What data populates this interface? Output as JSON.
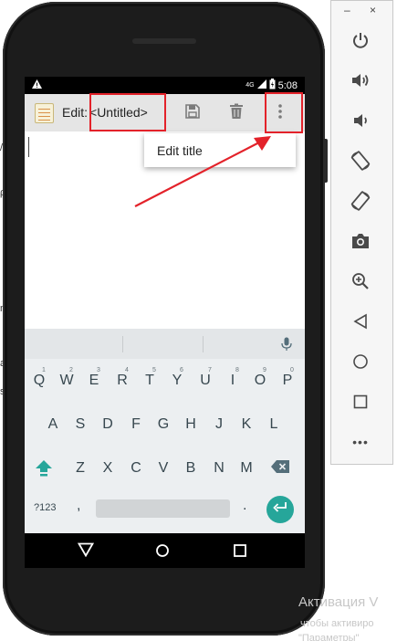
{
  "colors": {
    "accent_teal": "#26a69a",
    "highlight_red": "#e3222a",
    "actionbar_bg": "#e5e5e5",
    "keyboard_bg": "#eceff1"
  },
  "background_fragments": [
    "/",
    "ρ",
    "m",
    "a",
    "s"
  ],
  "status_bar": {
    "alert_icon": "warning-icon",
    "network": "4G",
    "battery_icon": "battery-charging-icon",
    "time": "5:08"
  },
  "action_bar": {
    "title_prefix": "Edit:",
    "title_value": "<Untitled>",
    "app_icon": "notepad-icon",
    "actions": [
      "save-icon",
      "delete-icon",
      "overflow-menu-icon"
    ]
  },
  "overflow_menu": {
    "items": [
      {
        "label": "Edit title"
      }
    ]
  },
  "keyboard": {
    "row1": [
      {
        "key": "Q",
        "hint": "1"
      },
      {
        "key": "W",
        "hint": "2"
      },
      {
        "key": "E",
        "hint": "3"
      },
      {
        "key": "R",
        "hint": "4"
      },
      {
        "key": "T",
        "hint": "5"
      },
      {
        "key": "Y",
        "hint": "6"
      },
      {
        "key": "U",
        "hint": "7"
      },
      {
        "key": "I",
        "hint": "8"
      },
      {
        "key": "O",
        "hint": "9"
      },
      {
        "key": "P",
        "hint": "0"
      }
    ],
    "row2": [
      "A",
      "S",
      "D",
      "F",
      "G",
      "H",
      "J",
      "K",
      "L"
    ],
    "row3": [
      "Z",
      "X",
      "C",
      "V",
      "B",
      "N",
      "M"
    ],
    "symbols_label": "?123",
    "comma": ",",
    "period": ".",
    "icons": [
      "microphone-icon",
      "shift-icon",
      "backspace-icon",
      "enter-icon"
    ]
  },
  "nav_bar": {
    "icons": [
      "back-icon",
      "home-icon",
      "recents-icon"
    ]
  },
  "emulator_toolbar": {
    "window_buttons": [
      "–",
      "×"
    ],
    "tools": [
      "power-icon",
      "volume-up-icon",
      "volume-down-icon",
      "rotate-left-icon",
      "rotate-right-icon",
      "camera-icon",
      "zoom-icon",
      "back-icon",
      "home-icon",
      "overview-icon"
    ],
    "more_label": "•••"
  },
  "watermark": {
    "line1": "Активация V",
    "line2": "чтобы активиро",
    "line3": "\"Параметры\""
  }
}
